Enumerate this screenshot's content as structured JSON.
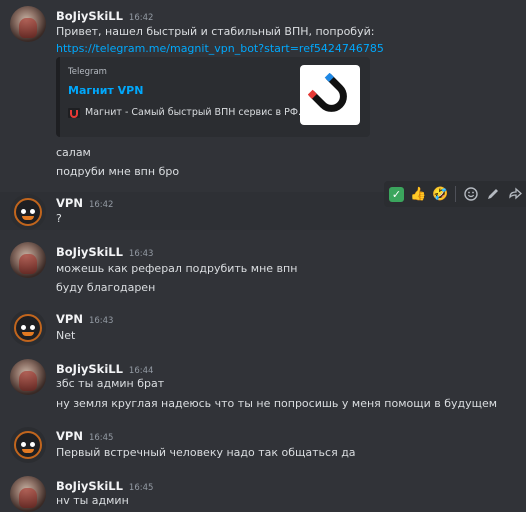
{
  "messages": [
    {
      "author": "BoJiySkiLL",
      "time": "16:42",
      "lines": [
        "Привет, нашел быстрый и стабильный ВПН, попробуй:",
        "https://telegram.me/magnit_vpn_bot?start=ref5424746785"
      ],
      "embed": {
        "provider": "Telegram",
        "title": "Магнит VPN",
        "description": "Магнит - Самый быстрый ВПН сервис в РФ."
      },
      "after_lines": [
        "салам",
        "подруби мне впн бро"
      ]
    },
    {
      "author": "VPN",
      "time": "16:42",
      "lines": [
        "?"
      ]
    },
    {
      "author": "BoJiySkiLL",
      "time": "16:43",
      "lines": [
        "можешь как реферал подрубить мне впн",
        "буду благодарен"
      ]
    },
    {
      "author": "VPN",
      "time": "16:43",
      "lines": [
        "Net"
      ]
    },
    {
      "author": "BoJiySkiLL",
      "time": "16:44",
      "lines": [
        "збс ты админ брат",
        "ну земля круглая надеюсь что ты не попросишь у меня помощи в будущем"
      ]
    },
    {
      "author": "VPN",
      "time": "16:45",
      "lines": [
        "Первый встречный человеку надо так общаться да"
      ]
    },
    {
      "author": "BoJiySkiLL",
      "time": "16:45",
      "lines": [
        "нv ты админ"
      ]
    }
  ],
  "toolbar": {
    "icons": [
      "check-reaction",
      "thumbs-up",
      "rofl-emoji",
      "add-reaction",
      "edit",
      "reply",
      "more"
    ]
  },
  "colors": {
    "background": "#313338",
    "link": "#00a8fc",
    "username": "#f2f3f5",
    "timestamp": "#949ba4"
  }
}
